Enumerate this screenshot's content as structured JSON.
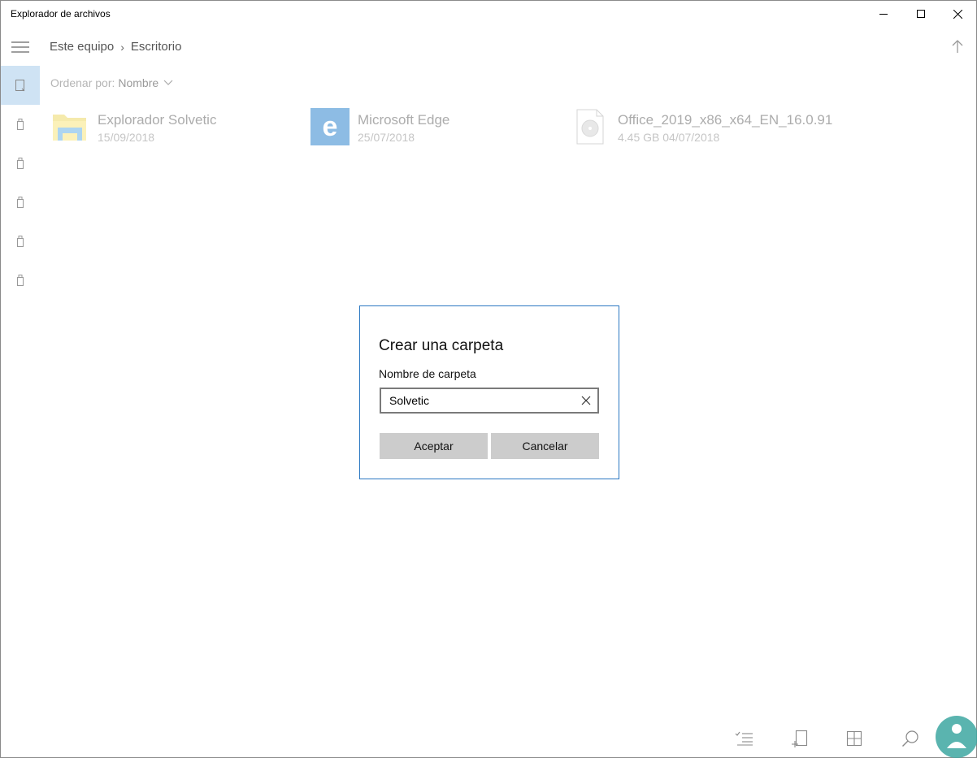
{
  "window": {
    "title": "Explorador de archivos",
    "icons": {
      "minimize": "minimize-icon",
      "maximize": "maximize-icon",
      "close": "close-icon"
    }
  },
  "nav": {
    "menu_icon": "hamburger-icon",
    "breadcrumb": [
      "Este equipo",
      "Escritorio"
    ],
    "separator": "›",
    "up_icon": "up-arrow-icon"
  },
  "sidebar": {
    "items": [
      {
        "icon": "tablet-icon",
        "selected": true
      },
      {
        "icon": "usb-drive-icon",
        "selected": false
      },
      {
        "icon": "usb-drive-icon",
        "selected": false
      },
      {
        "icon": "usb-drive-icon",
        "selected": false
      },
      {
        "icon": "usb-drive-icon",
        "selected": false
      },
      {
        "icon": "usb-drive-icon",
        "selected": false
      }
    ]
  },
  "sort": {
    "label": "Ordenar por:",
    "value": "Nombre"
  },
  "files": [
    {
      "name": "Explorador Solvetic",
      "meta": "15/09/2018",
      "icon": "folder-icon"
    },
    {
      "name": "Microsoft Edge",
      "meta": "25/07/2018",
      "icon": "edge-icon"
    },
    {
      "name": "Office_2019_x86_x64_EN_16.0.91",
      "meta": "4.45 GB 04/07/2018",
      "icon": "disc-image-icon"
    }
  ],
  "dialog": {
    "title": "Crear una carpeta",
    "label": "Nombre de carpeta",
    "value": "Solvetic",
    "ok": "Aceptar",
    "cancel": "Cancelar"
  },
  "toolbar": {
    "icons": [
      "select-list-icon",
      "new-item-icon",
      "grid-view-icon",
      "search-icon"
    ]
  },
  "colors": {
    "accent": "#2b78c2",
    "selected_bg": "#cfe3f4",
    "button_bg": "#cccccc"
  }
}
